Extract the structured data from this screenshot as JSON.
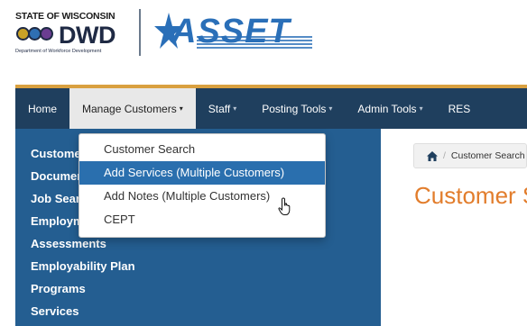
{
  "logo": {
    "state": "STATE OF WISCONSIN",
    "dwd": "DWD",
    "dept": "Department of Workforce Development",
    "asset": "ASSET"
  },
  "nav": {
    "items": [
      {
        "label": "Home",
        "caret": false
      },
      {
        "label": "Manage Customers",
        "caret": true
      },
      {
        "label": "Staff",
        "caret": true
      },
      {
        "label": "Posting Tools",
        "caret": true
      },
      {
        "label": "Admin Tools",
        "caret": true
      },
      {
        "label": "RES",
        "caret": false
      }
    ],
    "caret_glyph": "▾"
  },
  "dropdown": {
    "items": [
      "Customer Search",
      "Add Services (Multiple Customers)",
      "Add Notes (Multiple Customers)",
      "CEPT"
    ]
  },
  "sidebar": {
    "items": [
      "Customer",
      "Documents",
      "Job Search",
      "Employment",
      "Assessments",
      "Employability Plan",
      "Programs",
      "Services"
    ]
  },
  "breadcrumb": {
    "current": "Customer Search"
  },
  "page": {
    "title": "Customer Search"
  },
  "colors": {
    "navbar": "#1f3f5e",
    "nav_accent": "#d9a040",
    "sidebar": "#245e91",
    "dropdown_active": "#2a6fae",
    "title": "#e27d2c"
  }
}
